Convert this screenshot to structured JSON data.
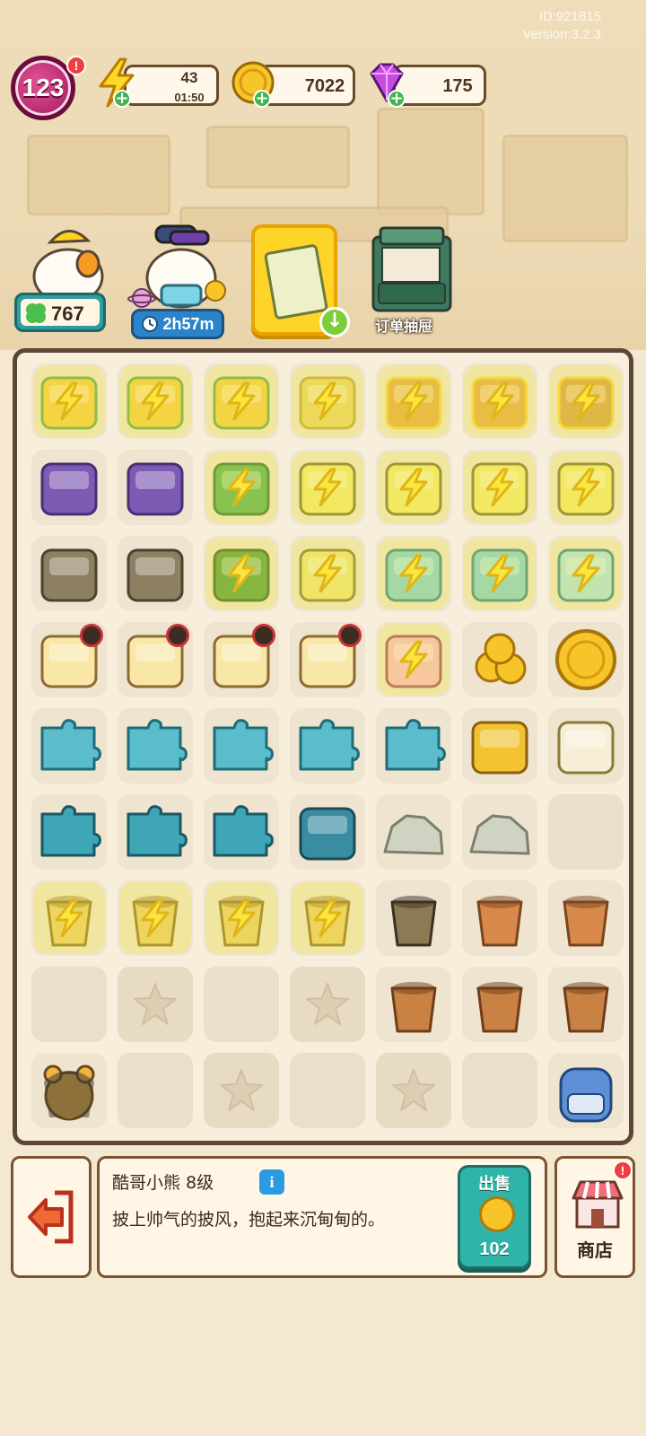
{
  "meta": {
    "player_id": "ID:921815",
    "version": "Version:3.2.3"
  },
  "resources": {
    "level": "123",
    "energy": {
      "value": "43",
      "timer": "01:50"
    },
    "coins": "7022",
    "gems": "175"
  },
  "characters": {
    "worker_count": "767",
    "delivery_timer": "2h57m",
    "order_drawer_label": "订单抽屉"
  },
  "board": {
    "rows": 9,
    "cols": 7
  },
  "selected_item": {
    "name": "酷哥小熊 8级",
    "description": "披上帅气的披风，抱起来沉甸甸的。",
    "sell_label": "出售",
    "sell_price": "102"
  },
  "bottom_bar": {
    "shop_label": "商店"
  },
  "colors": {
    "board_border": "#5c4636",
    "energy": "#f7ec48",
    "sell_button": "#2eb4a8",
    "level_badge": "#c0226d"
  }
}
